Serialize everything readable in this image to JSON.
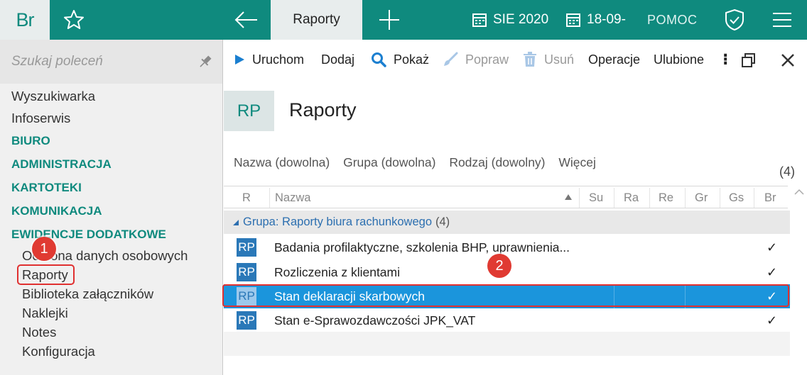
{
  "topbar": {
    "logo": "Br",
    "active_tab": "Raporty",
    "period": "SIE 2020",
    "date": "18-09-",
    "help": "POMOC"
  },
  "sidebar": {
    "search_placeholder": "Szukaj poleceń",
    "items": [
      "Wyszukiwarka",
      "Infoserwis"
    ],
    "categories": [
      "BIURO",
      "ADMINISTRACJA",
      "KARTOTEKI",
      "KOMUNIKACJA",
      "EWIDENCJE DODATKOWE"
    ],
    "subitems": [
      "Ochrona danych osobowych",
      "Raporty",
      "Biblioteka załączników",
      "Naklejki",
      "Notes",
      "Konfiguracja"
    ]
  },
  "badges": [
    "1",
    "2"
  ],
  "toolbar": {
    "run": "Uruchom",
    "add": "Dodaj",
    "show": "Pokaż",
    "edit": "Popraw",
    "delete": "Usuń",
    "operations": "Operacje",
    "favorites": "Ulubione"
  },
  "header": {
    "code": "RP",
    "title": "Raporty"
  },
  "filters": [
    "Nazwa (dowolna)",
    "Grupa (dowolna)",
    "Rodzaj (dowolny)",
    "Więcej"
  ],
  "count": "(4)",
  "columns": {
    "r": "R",
    "name": "Nazwa",
    "su": "Su",
    "ra": "Ra",
    "re": "Re",
    "gr": "Gr",
    "gs": "Gs",
    "br": "Br"
  },
  "group": {
    "label": "Grupa:",
    "value": "Raporty biura rachunkowego",
    "count": "(4)"
  },
  "rows": [
    {
      "code": "RP",
      "name": "Badania profilaktyczne, szkolenia BHP, uprawnienia...",
      "br": "✓"
    },
    {
      "code": "RP",
      "name": "Rozliczenia z klientami",
      "br": "✓"
    },
    {
      "code": "RP",
      "name": "Stan deklaracji skarbowych",
      "br": "✓"
    },
    {
      "code": "RP",
      "name": "Stan e-Sprawozdawczości JPK_VAT",
      "br": "✓"
    }
  ],
  "colors": {
    "accent": "#0f8a7e",
    "selection": "#1b95dc",
    "badge": "#e03a32",
    "category": "#0f8a7e"
  }
}
